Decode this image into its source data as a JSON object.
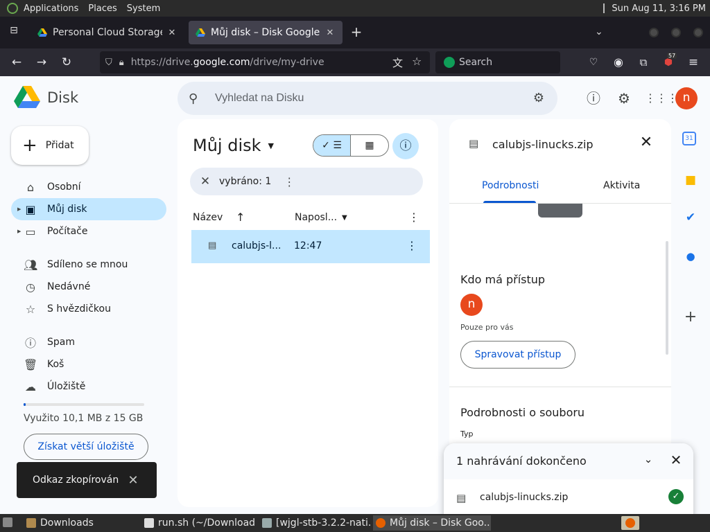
{
  "system_panel": {
    "menus": [
      "Applications",
      "Places",
      "System"
    ],
    "clock": "Sun Aug 11,  3:16 PM"
  },
  "browser": {
    "tabs": [
      {
        "title": "Personal Cloud Storage & Fi",
        "active": false
      },
      {
        "title": "Můj disk – Disk Google",
        "active": true
      }
    ],
    "url_prefix": "https://drive.",
    "url_domain": "google.com",
    "url_path": "/drive/my-drive",
    "search_placeholder": "Search",
    "extension_badge": "57"
  },
  "drive": {
    "logo_text": "Disk",
    "search_placeholder": "Vyhledat na Disku",
    "avatar_letter": "n",
    "new_button": "Přidat",
    "nav": [
      {
        "label": "Osobní",
        "icon": "home-icon",
        "active": false,
        "expandable": false
      },
      {
        "label": "Můj disk",
        "icon": "my-drive-icon",
        "active": true,
        "expandable": true
      },
      {
        "label": "Počítače",
        "icon": "computer-icon",
        "active": false,
        "expandable": true
      },
      {
        "label": "Sdíleno se mnou",
        "icon": "people-icon",
        "active": false,
        "expandable": false
      },
      {
        "label": "Nedávné",
        "icon": "clock-icon",
        "active": false,
        "expandable": false
      },
      {
        "label": "S hvězdičkou",
        "icon": "star-icon",
        "active": false,
        "expandable": false
      },
      {
        "label": "Spam",
        "icon": "spam-icon",
        "active": false,
        "expandable": false
      },
      {
        "label": "Koš",
        "icon": "trash-icon",
        "active": false,
        "expandable": false
      },
      {
        "label": "Úložiště",
        "icon": "cloud-icon",
        "active": false,
        "expandable": false
      }
    ],
    "storage_text": "Využito 10,1 MB z 15 GB",
    "storage_fraction": 0.0007,
    "storage_button": "Získat větší úložiště",
    "page_title": "Můj disk",
    "selection_text": "vybráno: 1",
    "columns": {
      "name": "Název",
      "modified": "Naposl..."
    },
    "files": [
      {
        "name": "calubjs-l...",
        "modified": "12:47",
        "selected": true
      }
    ]
  },
  "details_panel": {
    "file_name": "calubjs-linucks.zip",
    "tabs": [
      "Podrobnosti",
      "Aktivita"
    ],
    "access_heading": "Kdo má přístup",
    "owner_letter": "n",
    "access_note": "Pouze pro vás",
    "manage_button": "Spravovat přístup",
    "file_details_heading": "Podrobnosti o souboru",
    "type_label": "Typ"
  },
  "upload": {
    "title": "1 nahrávání dokončeno",
    "file": "calubjs-linucks.zip"
  },
  "snackbar": {
    "text": "Odkaz zkopírován"
  },
  "taskbar": {
    "items": [
      {
        "label": "Downloads",
        "active": false
      },
      {
        "label": "run.sh (~/Download...",
        "active": false
      },
      {
        "label": "[wjgl-stb-3.2.2-nati...",
        "active": false
      },
      {
        "label": "Můj disk – Disk Goo...",
        "active": true
      }
    ]
  },
  "colors": {
    "accent_blue": "#0b57d0",
    "selection_blue": "#c2e7ff",
    "avatar_orange": "#e8491d",
    "success_green": "#188038"
  }
}
